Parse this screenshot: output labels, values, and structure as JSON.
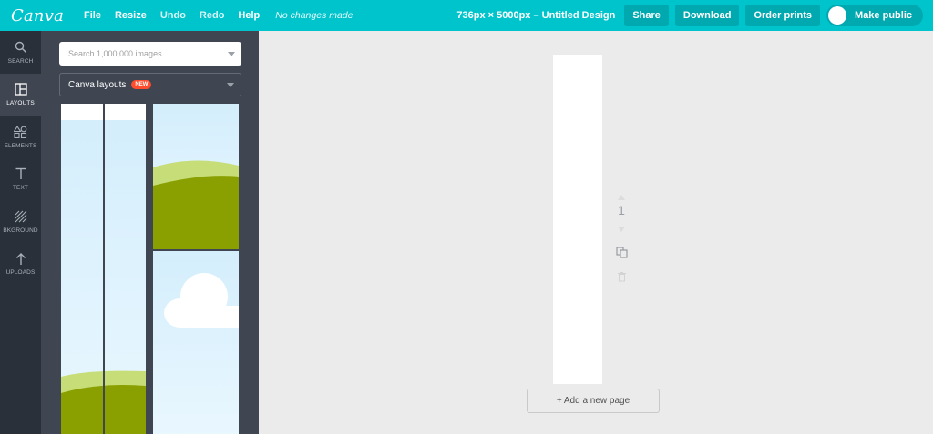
{
  "app": {
    "logo": "Canva"
  },
  "menu": {
    "file": "File",
    "resize": "Resize",
    "undo": "Undo",
    "redo": "Redo",
    "help": "Help",
    "status": "No changes made"
  },
  "design": {
    "title": "736px × 5000px – Untitled Design"
  },
  "actions": {
    "share": "Share",
    "download": "Download",
    "order_prints": "Order prints",
    "make_public": "Make public"
  },
  "sidebar": {
    "items": [
      {
        "label": "SEARCH",
        "icon": "search-icon",
        "active": false
      },
      {
        "label": "LAYOUTS",
        "icon": "layouts-icon",
        "active": true
      },
      {
        "label": "ELEMENTS",
        "icon": "elements-icon",
        "active": false
      },
      {
        "label": "TEXT",
        "icon": "text-icon",
        "active": false
      },
      {
        "label": "BKGROUND",
        "icon": "background-icon",
        "active": false
      },
      {
        "label": "UPLOADS",
        "icon": "upload-icon",
        "active": false
      }
    ]
  },
  "panel": {
    "search_placeholder": "Search 1,000,000 images...",
    "dropdown_label": "Canva layouts",
    "badge": "NEW"
  },
  "colors": {
    "brand": "#00c4cc",
    "button": "#00a8b0",
    "rail": "#293039",
    "panel": "#3f4652",
    "grass_dark": "#8aa000",
    "grass_light": "#c7dd78"
  },
  "workspace": {
    "page_number": "1",
    "add_page": "+ Add a new page"
  }
}
